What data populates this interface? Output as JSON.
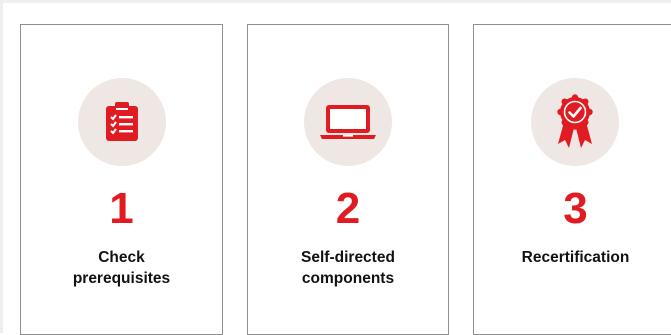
{
  "colors": {
    "accent": "#e11b22",
    "icon_background": "#eee7e3",
    "card_border": "#8f8f8f",
    "text": "#111111"
  },
  "steps": [
    {
      "number": "1",
      "label": "Check prerequisites",
      "icon": "clipboard-checklist-icon"
    },
    {
      "number": "2",
      "label": "Self-directed components",
      "icon": "laptop-icon"
    },
    {
      "number": "3",
      "label": "Recertification",
      "icon": "award-ribbon-icon"
    }
  ]
}
